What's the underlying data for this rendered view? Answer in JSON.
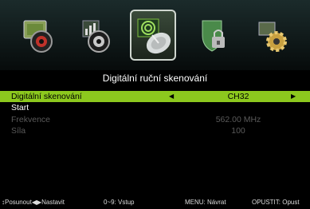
{
  "menu": {
    "categories": [
      "picture",
      "channel",
      "satellite",
      "lock",
      "settings"
    ],
    "selected_category": "satellite"
  },
  "title": "Digitální ruční skenování",
  "rows": [
    {
      "label": "Digitální skenování",
      "value": "CH32"
    },
    {
      "label": "Start",
      "value": ""
    },
    {
      "label": "Frekvence",
      "value": "562.00 MHz"
    },
    {
      "label": "Síla",
      "value": "100"
    }
  ],
  "footer": {
    "move": "Posunout",
    "set": "Nastavit",
    "numeric": "0~9: Vstup",
    "menu": "MENU: Návrat",
    "exit": "OPUSTIT: Opust"
  },
  "colors": {
    "highlight": "#8cc81e",
    "background": "#000000"
  }
}
